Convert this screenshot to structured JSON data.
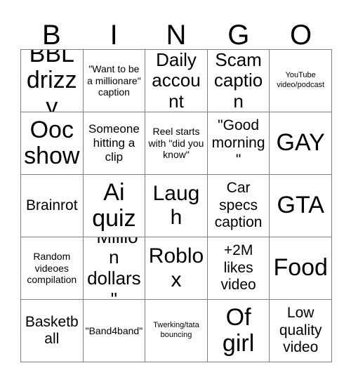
{
  "card": {
    "header_letters": [
      "B",
      "I",
      "N",
      "G",
      "O"
    ],
    "rows": [
      [
        {
          "text": "BBL drizzy",
          "size": "s-xxl"
        },
        {
          "text": "\"Want to be a millionare\" caption",
          "size": "s-xs"
        },
        {
          "text": "Daily account",
          "size": "s-lg"
        },
        {
          "text": "Scam caption",
          "size": "s-lg"
        },
        {
          "text": "YouTube video/podcast",
          "size": "s-xxs"
        }
      ],
      [
        {
          "text": "Ooc show",
          "size": "s-xxl"
        },
        {
          "text": "Someone hitting a clip",
          "size": "s-sm"
        },
        {
          "text": "Reel starts with \"did you know\"",
          "size": "s-xs"
        },
        {
          "text": "\"Good morning\"",
          "size": "s-md"
        },
        {
          "text": "GAY",
          "size": "s-xxl"
        }
      ],
      [
        {
          "text": "Brainrot",
          "size": "s-md"
        },
        {
          "text": "Ai quiz",
          "size": "s-xxl"
        },
        {
          "text": "Laugh",
          "size": "s-xl"
        },
        {
          "text": "Car specs caption",
          "size": "s-md"
        },
        {
          "text": "GTA",
          "size": "s-xxl"
        }
      ],
      [
        {
          "text": "Random videoes compilation",
          "size": "s-xs"
        },
        {
          "text": "\"Million dollars\"",
          "size": "s-lg"
        },
        {
          "text": "Roblox",
          "size": "s-xl"
        },
        {
          "text": "+2M likes video",
          "size": "s-md"
        },
        {
          "text": "Food",
          "size": "s-xxl"
        }
      ],
      [
        {
          "text": "Basketball",
          "size": "s-md"
        },
        {
          "text": "\"Band4band\"",
          "size": "s-xs"
        },
        {
          "text": "Twerking/tata bouncing",
          "size": "s-xxs"
        },
        {
          "text": "Of girl",
          "size": "s-xxl"
        },
        {
          "text": "Low quality video",
          "size": "s-md"
        }
      ]
    ]
  },
  "style": {
    "border_color": "#808080",
    "text_color": "#000000",
    "background_color": "#ffffff"
  }
}
